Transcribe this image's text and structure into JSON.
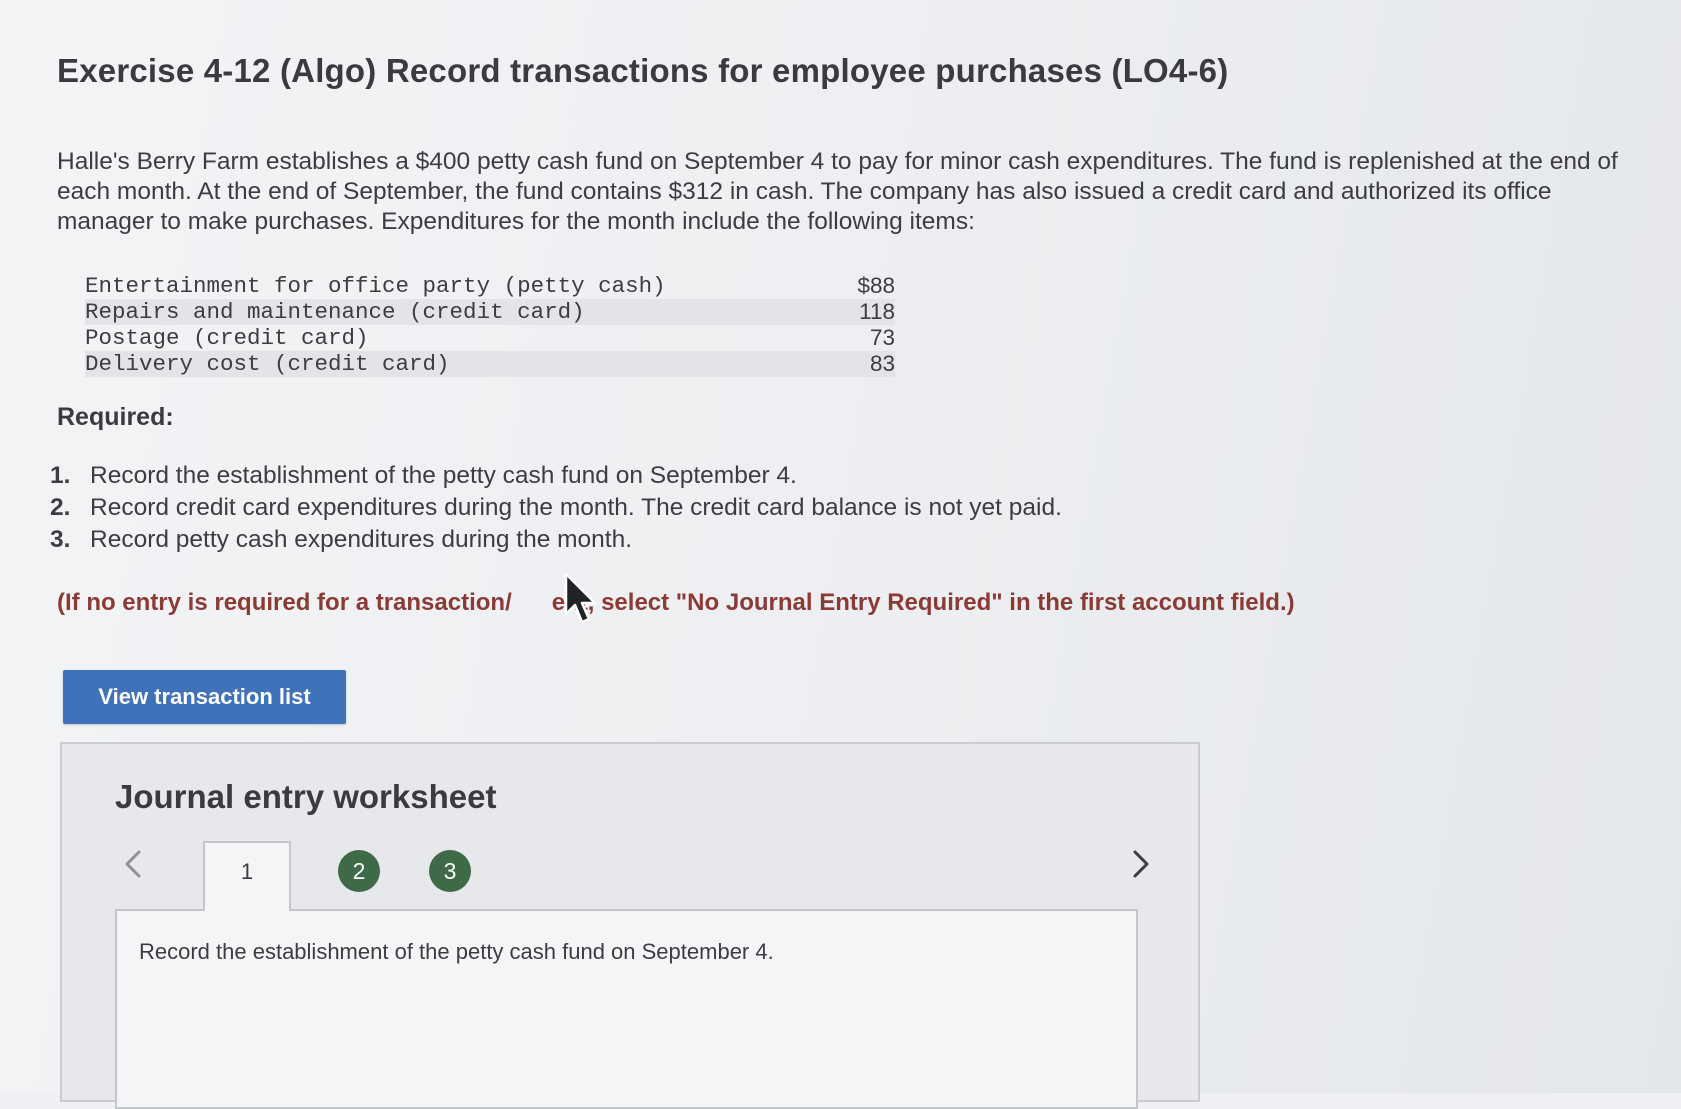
{
  "title": "Exercise 4-12 (Algo) Record transactions for employee purchases (LO4-6)",
  "intro": "Halle's Berry Farm establishes a $400 petty cash fund on September 4 to pay for minor cash expenditures. The fund is replenished at the end of each month. At the end of September, the fund contains $312 in cash. The company has also issued a credit card and authorized its office manager to make purchases. Expenditures for the month include the following items:",
  "expenses": [
    {
      "desc": "Entertainment for office party (petty cash)",
      "amount": "$88"
    },
    {
      "desc": "Repairs and maintenance (credit card)",
      "amount": "118"
    },
    {
      "desc": "Postage (credit card)",
      "amount": "73"
    },
    {
      "desc": "Delivery cost (credit card)",
      "amount": "83"
    }
  ],
  "required": {
    "label": "Required:",
    "items": [
      {
        "num": "1.",
        "text": "Record the establishment of the petty cash fund on September 4."
      },
      {
        "num": "2.",
        "text": "Record credit card expenditures during the month. The credit card balance is not yet paid."
      },
      {
        "num": "3.",
        "text": "Record petty cash expenditures during the month."
      }
    ]
  },
  "note_before_cursor": "(If no entry is required for a transaction/",
  "note_after_cursor": "ent, select \"No Journal Entry Required\" in the first account field.)",
  "view_button_label": "View transaction list",
  "worksheet": {
    "title": "Journal entry worksheet",
    "tabs": [
      "1",
      "2",
      "3"
    ],
    "active_tab": "1",
    "instruction": "Record the establishment of the petty cash fund on September 4."
  },
  "colors": {
    "button_blue": "#3f72b8",
    "tab_circle_green": "#3f6a48",
    "note_red": "#8a3b35"
  }
}
